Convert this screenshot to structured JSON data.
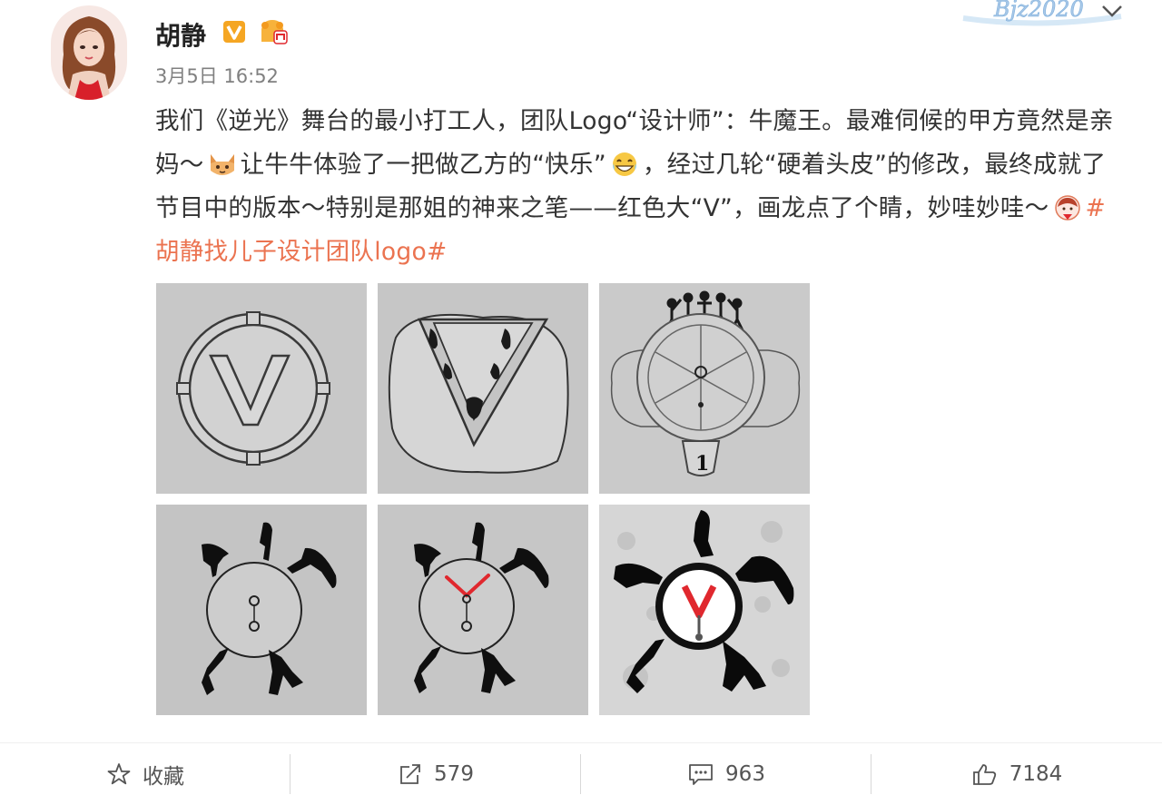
{
  "user": {
    "name": "胡静",
    "time": "3月5日 16:52"
  },
  "watermark": "Bjz2020",
  "post": {
    "seg1": "我们《逆光》舞台的最小打工人，团队Logo“设计师”：牛魔王。最难伺候的甲方竟然是亲妈～",
    "seg2": "让牛牛体验了一把做乙方的“快乐”",
    "seg3": "，经过几轮“硬着头皮”的修改，最终成就了节目中的版本～特别是那姐的神来之笔——红色大“V”，画龙点了个睛，妙哇妙哇～",
    "topic": "#胡静找儿子设计团队logo#"
  },
  "images": [
    {
      "name": "sketch-circle-v"
    },
    {
      "name": "sketch-v-dancers"
    },
    {
      "name": "sketch-figures-circle"
    },
    {
      "name": "clock-silhouettes"
    },
    {
      "name": "clock-red-v-hands"
    },
    {
      "name": "final-logo-red-v"
    }
  ],
  "toolbar": {
    "favorite_label": "收藏",
    "repost_count": "579",
    "comment_count": "963",
    "like_count": "7184"
  },
  "icons": {
    "verified": "verified-v-icon",
    "fan": "fan-badge-icon",
    "favorite": "star-icon",
    "repost": "share-icon",
    "comment": "comment-icon",
    "like": "thumbs-up-icon"
  },
  "colors": {
    "topic": "#eb7350",
    "verified": "#f5a623",
    "accent_red": "#e0282e"
  }
}
